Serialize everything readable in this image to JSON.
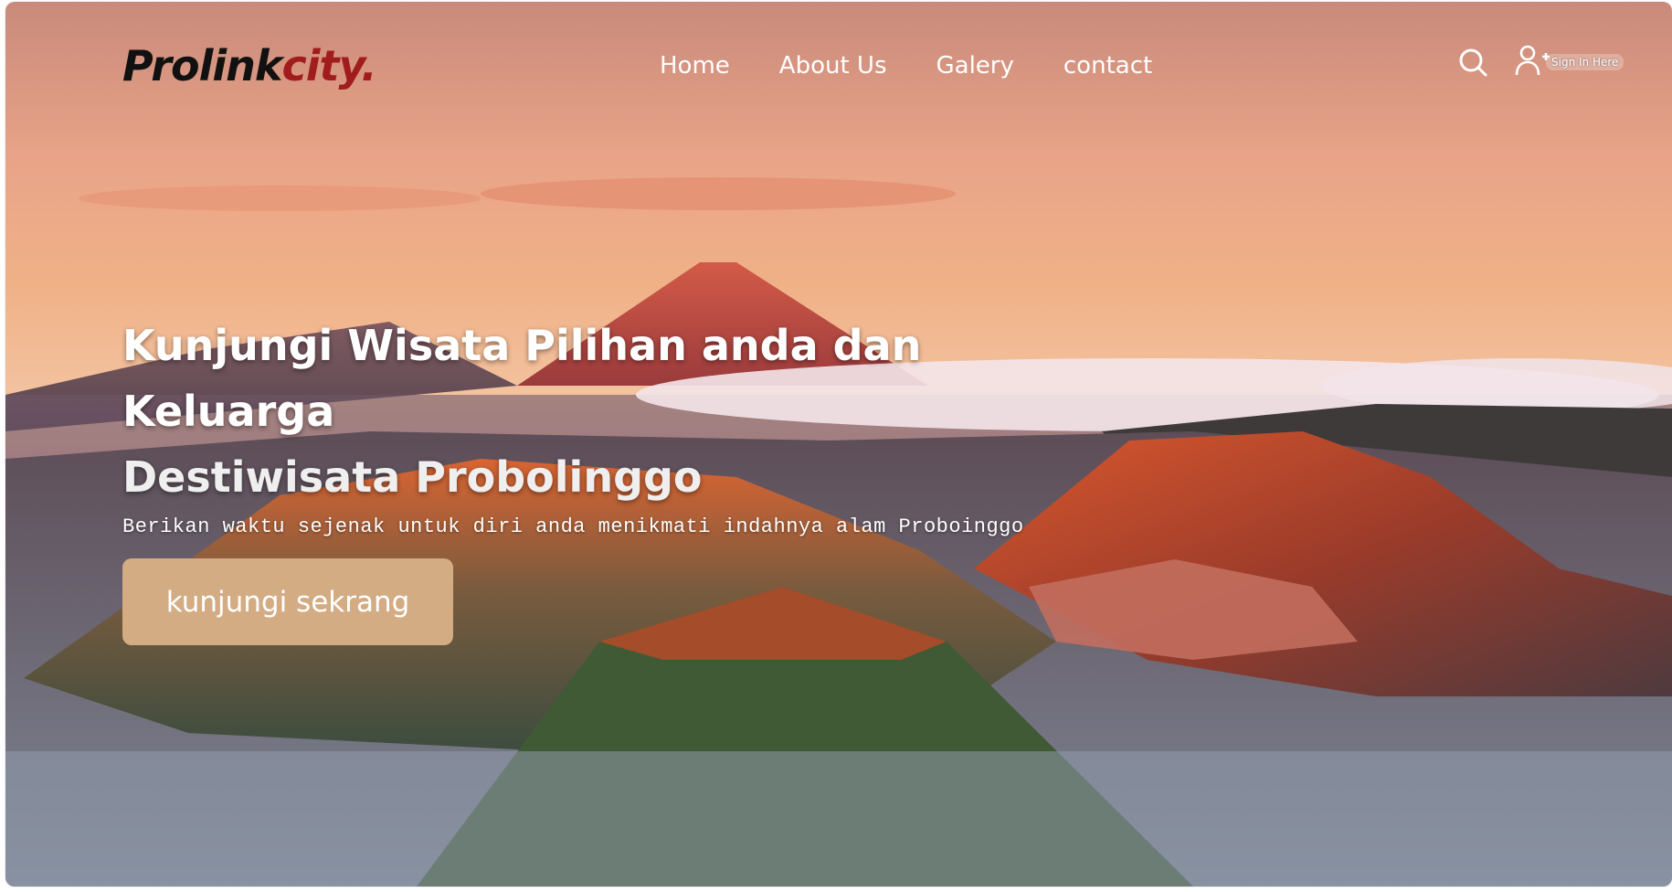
{
  "brand": {
    "name_primary": "Prolink",
    "name_accent": "city.",
    "accent_color": "#a11d1d"
  },
  "nav": {
    "links": [
      {
        "label": "Home"
      },
      {
        "label": "About Us"
      },
      {
        "label": "Galery"
      },
      {
        "label": "contact"
      }
    ],
    "search_icon": "search-icon",
    "user_icon": "user-plus-icon",
    "signin_label": "Sign In Here"
  },
  "hero": {
    "title": "Kunjungi Wisata Pilihan anda dan Keluarga",
    "subtitle": "Destiwisata Probolinggo",
    "description": "Berikan waktu sejenak untuk diri anda menikmati indahnya alam Proboinggo",
    "cta_label": "kunjungi sekrang",
    "cta_color": "#d3ac84",
    "background_image": "mountain-volcano-sunrise"
  }
}
